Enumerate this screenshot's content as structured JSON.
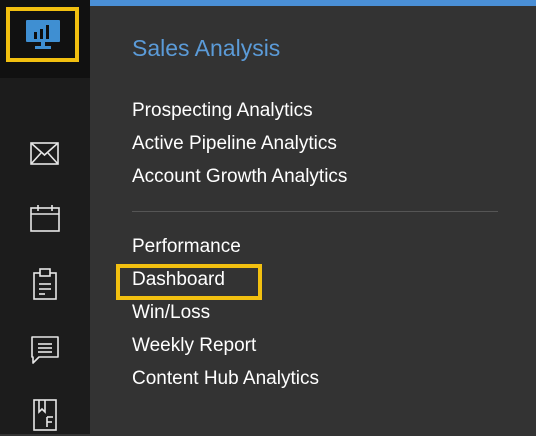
{
  "sidebar": {
    "icons": [
      {
        "name": "analytics-dashboard-icon"
      },
      {
        "name": "mail-icon"
      },
      {
        "name": "calendar-icon"
      },
      {
        "name": "clipboard-icon"
      },
      {
        "name": "chat-icon"
      },
      {
        "name": "bookmark-icon"
      }
    ]
  },
  "panel": {
    "title": "Sales Analysis",
    "group1": [
      "Prospecting Analytics",
      "Active Pipeline Analytics",
      "Account Growth Analytics"
    ],
    "group2": [
      "Performance",
      "Dashboard",
      "Win/Loss",
      "Weekly Report",
      "Content Hub Analytics"
    ]
  },
  "colors": {
    "accent": "#4a8fd6",
    "highlight": "#f2c010",
    "panel_bg": "#333333",
    "rail_bg": "#1c1c1c"
  }
}
